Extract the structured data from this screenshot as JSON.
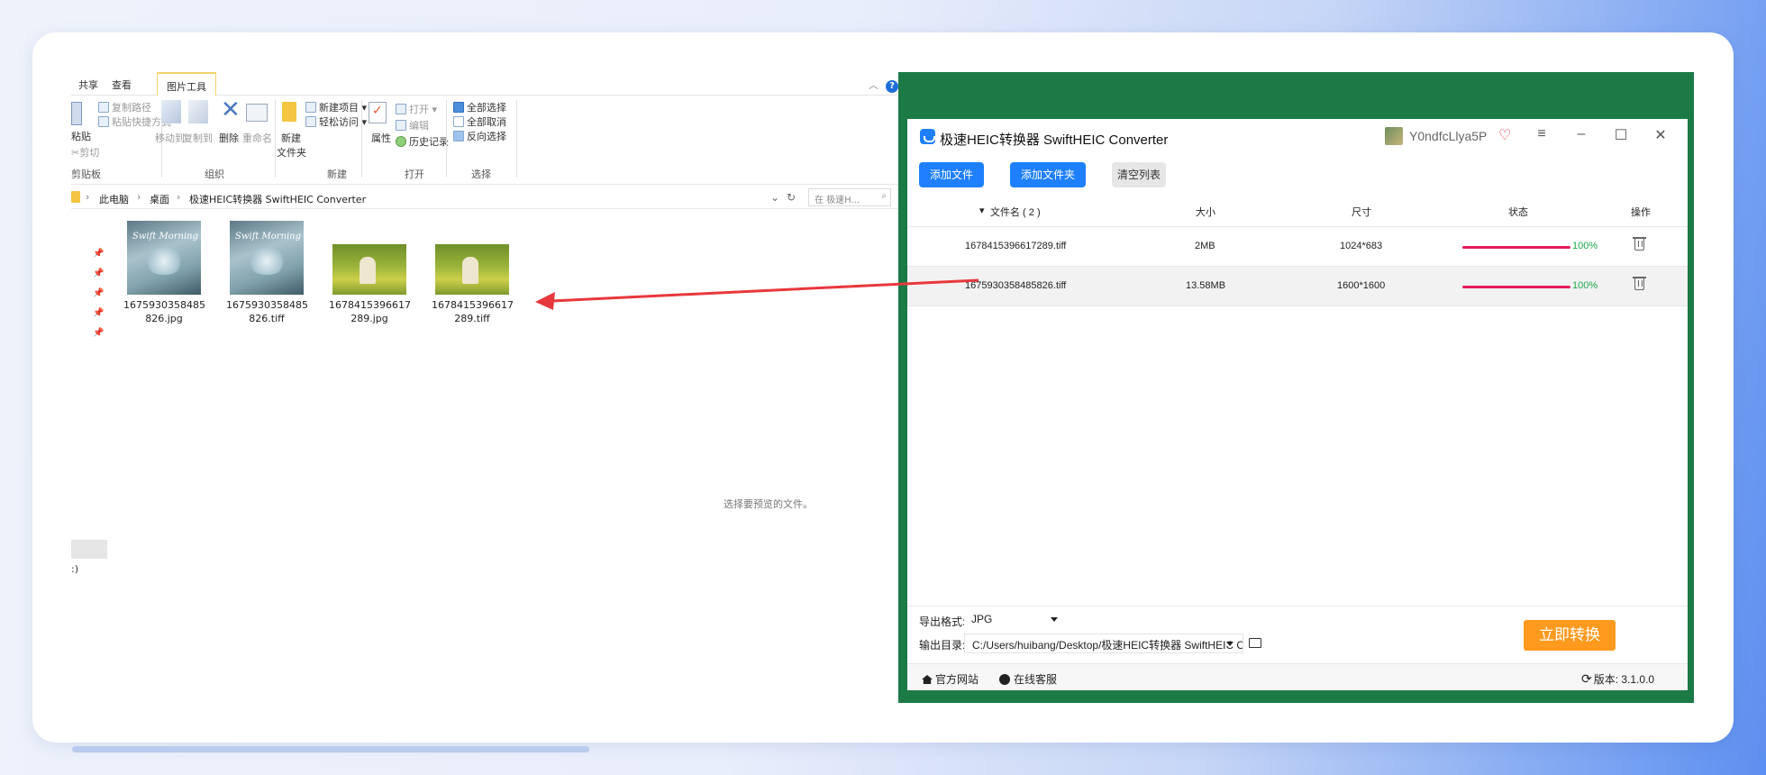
{
  "explorer": {
    "tabs": [
      "共享",
      "查看",
      "图片工具"
    ],
    "ribbon": {
      "clipboard": {
        "paste": "粘贴",
        "copy_path": "复制路径",
        "paste_shortcut": "粘贴快捷方式",
        "cut": "剪切",
        "group": "剪贴板"
      },
      "organize": {
        "move_to": "移动到",
        "copy_to": "复制到",
        "delete": "删除",
        "rename": "重命名",
        "group": "组织"
      },
      "new": {
        "new_folder_line1": "新建",
        "new_folder_line2": "文件夹",
        "new_item": "新建项目",
        "easy_access": "轻松访问",
        "group": "新建"
      },
      "open": {
        "properties": "属性",
        "open": "打开",
        "edit": "编辑",
        "history": "历史记录",
        "group": "打开"
      },
      "select": {
        "select_all": "全部选择",
        "select_none": "全部取消",
        "invert": "反向选择",
        "group": "选择"
      }
    },
    "breadcrumb": [
      "此电脑",
      "桌面",
      "极速HEIC转换器 SwiftHEIC Converter"
    ],
    "search_placeholder": "在 极速H...",
    "files": [
      {
        "name_line1": "1675930358485",
        "name_line2": "826.jpg",
        "thumb": "blue",
        "script": "Swift Morning"
      },
      {
        "name_line1": "1675930358485",
        "name_line2": "826.tiff",
        "thumb": "blue",
        "script": "Swift Morning"
      },
      {
        "name_line1": "1678415396617",
        "name_line2": "289.jpg",
        "thumb": "green"
      },
      {
        "name_line1": "1678415396617",
        "name_line2": "289.tiff",
        "thumb": "green"
      }
    ],
    "preview_text": "选择要预览的文件。",
    "side_text": ":)"
  },
  "converter": {
    "title": "极速HEIC转换器 SwiftHEIC Converter",
    "user": "Y0ndfcLlya5P",
    "toolbar": {
      "add_file": "添加文件",
      "add_folder": "添加文件夹",
      "clear_list": "清空列表"
    },
    "table": {
      "headers": {
        "name": "文件名 ( 2 )",
        "size": "大小",
        "dims": "尺寸",
        "status": "状态",
        "action": "操作"
      },
      "rows": [
        {
          "name": "1678415396617289.tiff",
          "size": "2MB",
          "dims": "1024*683",
          "progress": "100%"
        },
        {
          "name": "1675930358485826.tiff",
          "size": "13.58MB",
          "dims": "1600*1600",
          "progress": "100%"
        }
      ]
    },
    "output": {
      "format_label": "导出格式:",
      "format_value": "JPG",
      "dir_label": "输出目录:",
      "dir_value": "C:/Users/huibang/Desktop/极速HEIC转换器 SwiftHEIC Converter"
    },
    "convert_button": "立即转换",
    "status": {
      "website": "官方网站",
      "support": "在线客服",
      "version": "版本: 3.1.0.0"
    }
  },
  "colors": {
    "accent": "#1e80ff",
    "convert": "#ff9a1f",
    "progress": "#e5195a",
    "pct": "#1ca84a",
    "frame": "#1b7a45",
    "arrow": "#e8383d"
  }
}
